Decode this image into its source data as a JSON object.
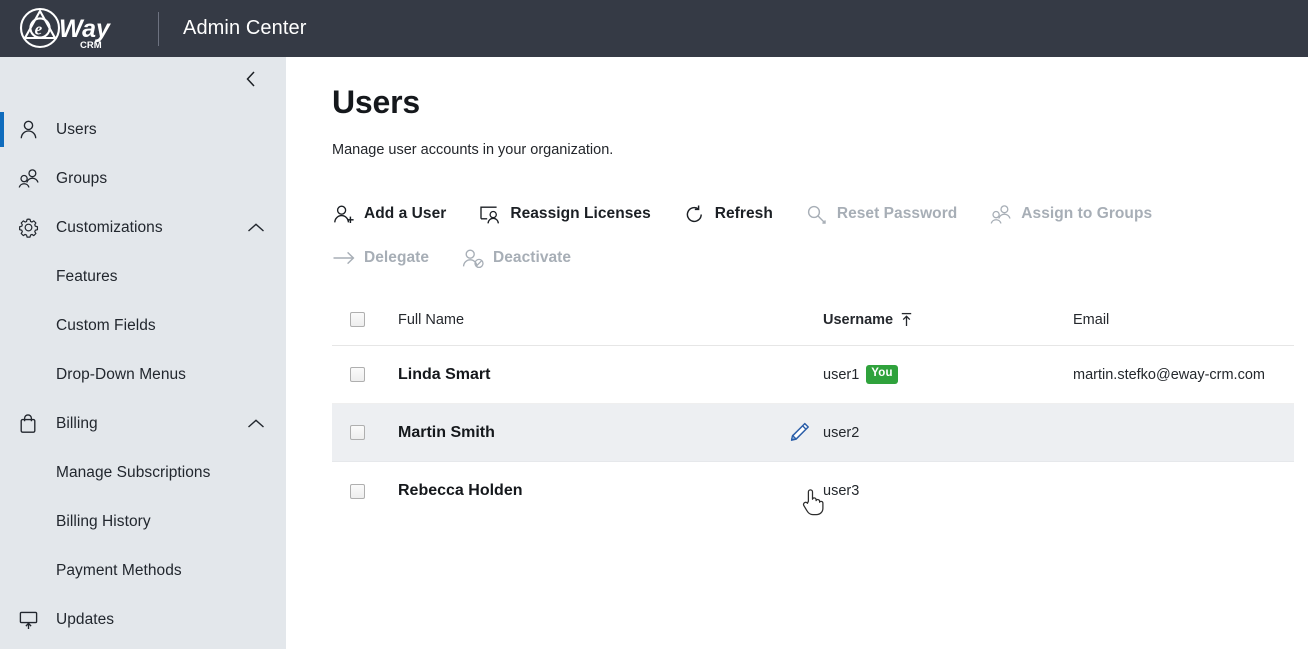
{
  "topbar": {
    "brand_name": "eWay",
    "brand_sub": "CRM",
    "title": "Admin Center"
  },
  "sidebar": {
    "collapse_icon": "chevron-left-icon",
    "items": [
      {
        "label": "Users",
        "icon": "person-icon",
        "type": "item",
        "active": true
      },
      {
        "label": "Groups",
        "icon": "people-icon",
        "type": "item",
        "active": false
      },
      {
        "label": "Customizations",
        "icon": "gear-icon",
        "type": "item",
        "active": false,
        "expanded": true,
        "chevron": "chevron-up-icon"
      },
      {
        "label": "Features",
        "type": "sub"
      },
      {
        "label": "Custom Fields",
        "type": "sub"
      },
      {
        "label": "Drop-Down Menus",
        "type": "sub"
      },
      {
        "label": "Billing",
        "icon": "bag-icon",
        "type": "item",
        "active": false,
        "expanded": true,
        "chevron": "chevron-up-icon"
      },
      {
        "label": "Manage Subscriptions",
        "type": "sub"
      },
      {
        "label": "Billing History",
        "type": "sub"
      },
      {
        "label": "Payment Methods",
        "type": "sub"
      },
      {
        "label": "Updates",
        "icon": "monitor-update-icon",
        "type": "item",
        "active": false
      }
    ]
  },
  "main": {
    "title": "Users",
    "subtitle": "Manage user accounts in your organization."
  },
  "toolbar": {
    "commands": [
      {
        "label": "Add a User",
        "icon": "person-add-icon",
        "disabled": false
      },
      {
        "label": "Reassign Licenses",
        "icon": "screen-person-icon",
        "disabled": false
      },
      {
        "label": "Refresh",
        "icon": "refresh-icon",
        "disabled": false
      },
      {
        "label": "Reset Password",
        "icon": "key-icon",
        "disabled": true
      },
      {
        "label": "Assign to Groups",
        "icon": "people-icon",
        "disabled": true
      },
      {
        "label": "Delegate",
        "icon": "arrow-right-icon",
        "disabled": true
      },
      {
        "label": "Deactivate",
        "icon": "person-block-icon",
        "disabled": true
      }
    ]
  },
  "table": {
    "columns": [
      {
        "key": "full_name",
        "label": "Full Name",
        "sorted": false
      },
      {
        "key": "username",
        "label": "Username",
        "sorted": true,
        "sort_dir": "asc",
        "sort_icon": "sort-ascending-icon"
      },
      {
        "key": "email",
        "label": "Email",
        "sorted": false
      }
    ],
    "rows": [
      {
        "full_name": "Linda Smart",
        "username": "user1",
        "badge": "You",
        "email": "martin.stefko@eway-crm.com",
        "hover": false
      },
      {
        "full_name": "Martin Smith",
        "username": "user2",
        "badge": "",
        "email": "",
        "hover": true
      },
      {
        "full_name": "Rebecca Holden",
        "username": "user3",
        "badge": "",
        "email": "",
        "hover": false
      }
    ]
  },
  "colors": {
    "topbar_bg": "#353A45",
    "sidebar_bg": "#E3E7EB",
    "accent": "#0F6CBD",
    "badge_green": "#2FA23C",
    "disabled_text": "#A7AEB6",
    "row_hover": "#EDEFF2"
  },
  "cursor": {
    "type": "pointer-hand",
    "edit_icon": "pencil-edit-icon"
  }
}
